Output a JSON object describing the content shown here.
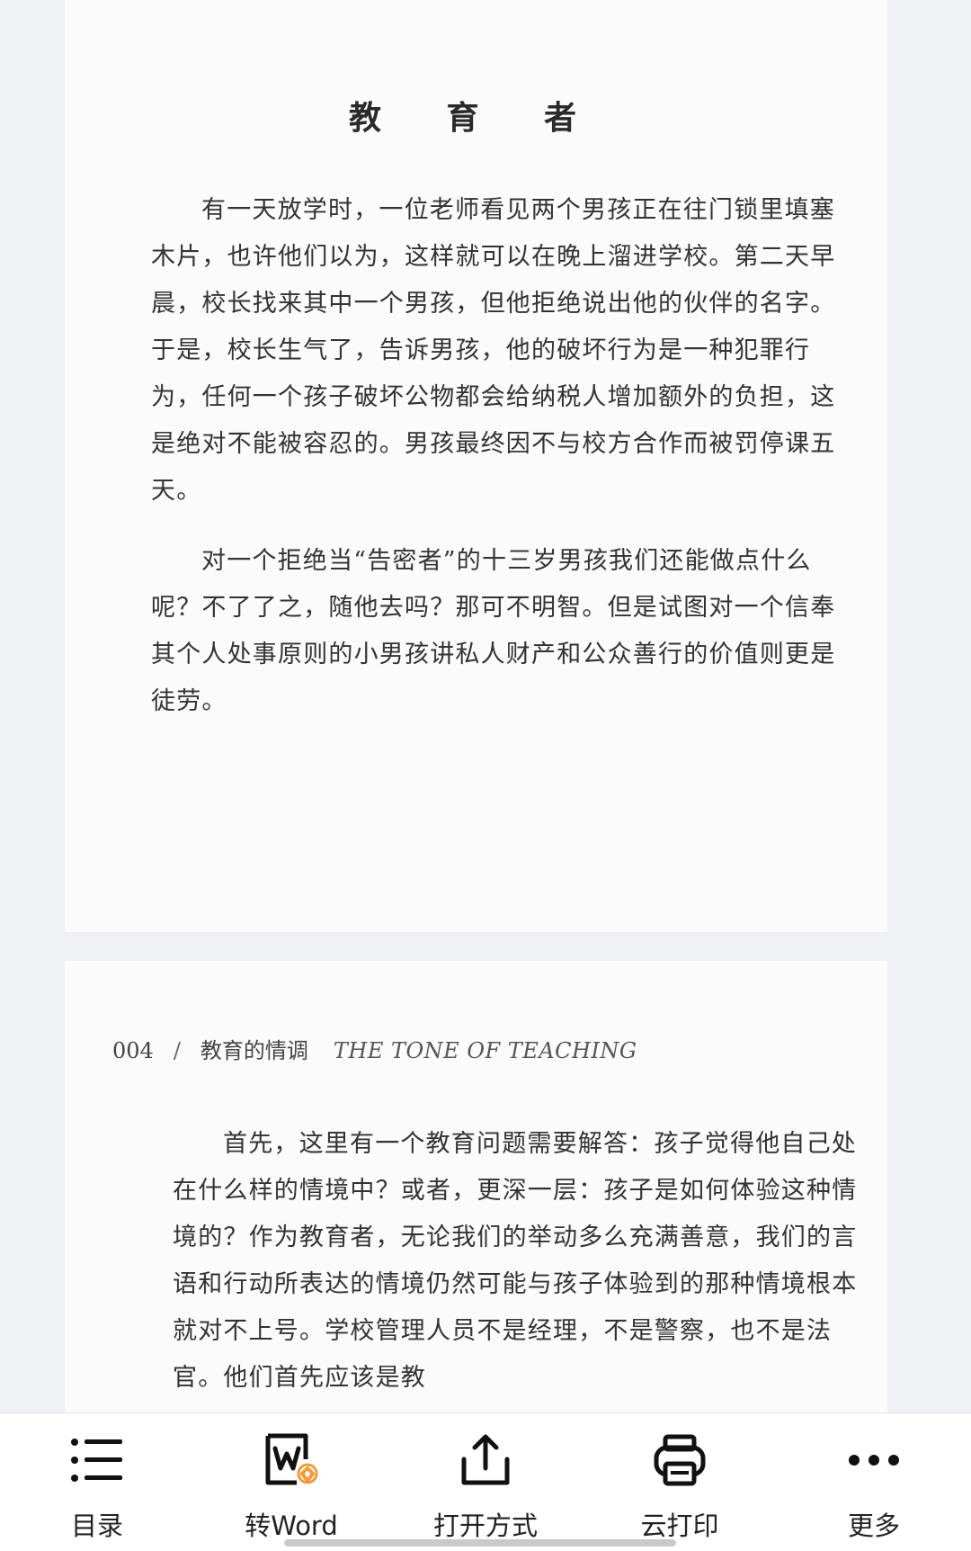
{
  "document": {
    "page1": {
      "title": "教 育 者",
      "paragraphs": [
        "有一天放学时，一位老师看见两个男孩正在往门锁里填塞木片，也许他们以为，这样就可以在晚上溜进学校。第二天早晨，校长找来其中一个男孩，但他拒绝说出他的伙伴的名字。于是，校长生气了，告诉男孩，他的破坏行为是一种犯罪行为，任何一个孩子破坏公物都会给纳税人增加额外的负担，这是绝对不能被容忍的。男孩最终因不与校方合作而被罚停课五天。",
        "对一个拒绝当“告密者”的十三岁男孩我们还能做点什么呢？不了了之，随他去吗？那可不明智。但是试图对一个信奉其个人处事原则的小男孩讲私人财产和公众善行的价值则更是徒劳。"
      ]
    },
    "page2": {
      "page_number": "004",
      "separator": "/",
      "book_title_cn": "教育的情调",
      "book_title_en": "THE TONE OF TEACHING",
      "paragraphs": [
        "首先，这里有一个教育问题需要解答：孩子觉得他自己处在什么样的情境中？或者，更深一层：孩子是如何体验这种情境的？作为教育者，无论我们的举动多么充满善意，我们的言语和行动所表达的情境仍然可能与孩子体验到的那种情境根本就对不上号。学校管理人员不是经理，不是警察，也不是法官。他们首先应该是教"
      ]
    }
  },
  "toolbar": {
    "items": [
      {
        "label": "目录",
        "icon": "list-icon"
      },
      {
        "label": "转Word",
        "icon": "convert-word-icon"
      },
      {
        "label": "打开方式",
        "icon": "share-icon"
      },
      {
        "label": "云打印",
        "icon": "printer-icon"
      },
      {
        "label": "更多",
        "icon": "more-icon"
      }
    ],
    "accent_color": "#f29b38"
  }
}
